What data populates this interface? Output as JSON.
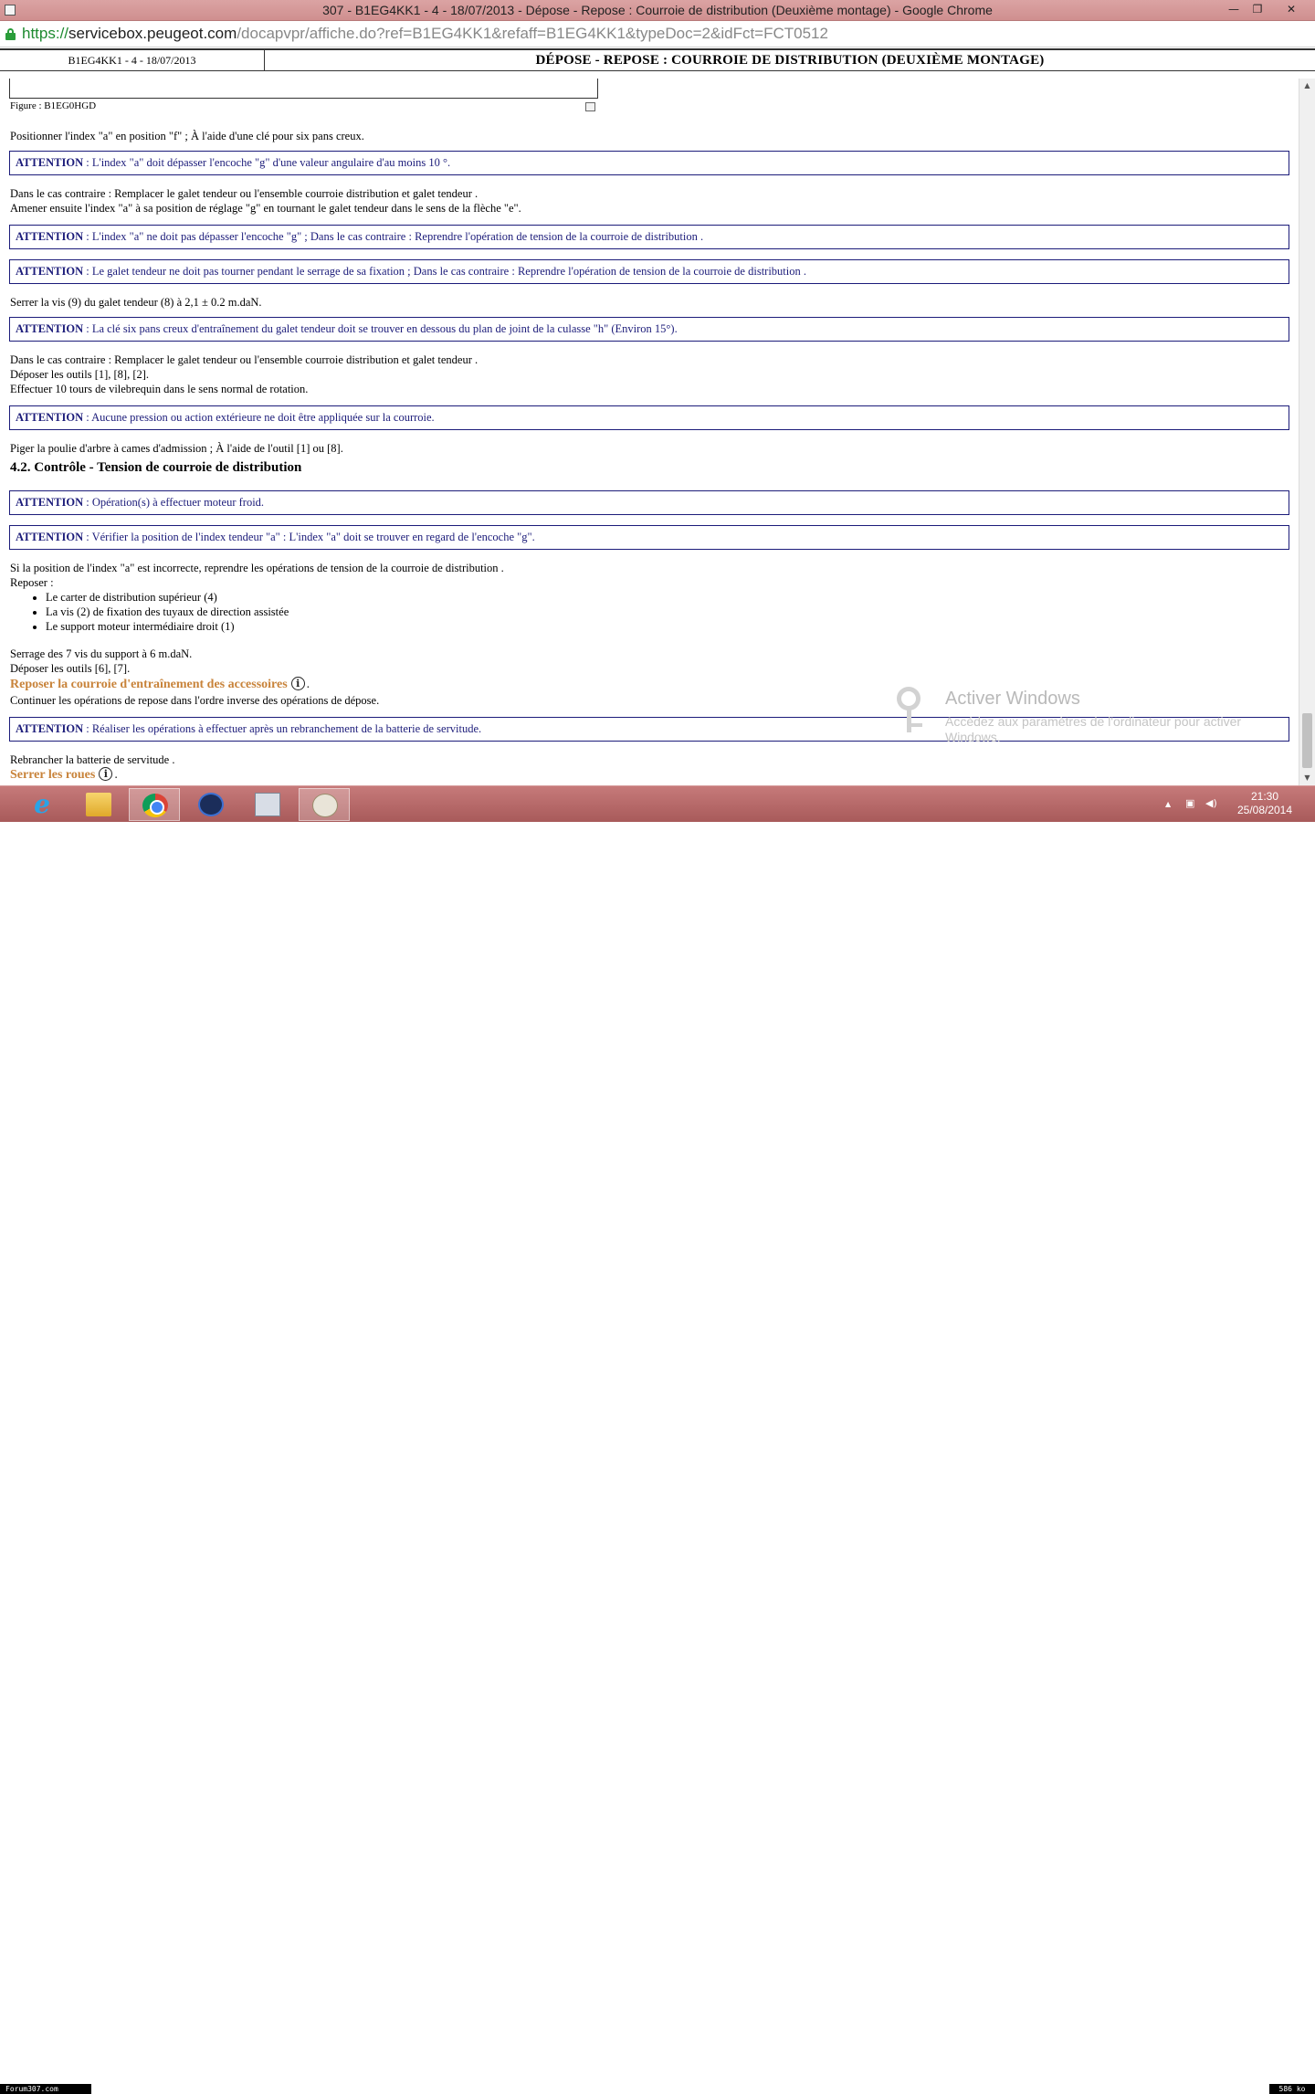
{
  "window": {
    "title": "307 - B1EG4KK1 - 4 - 18/07/2013 - Dépose - Repose : Courroie de distribution (Deuxième montage) - Google Chrome",
    "controls": {
      "minimize": "—",
      "restore": "❐",
      "close": "✕"
    }
  },
  "address": {
    "scheme": "https://",
    "host": "servicebox.peugeot.com",
    "path": "/docapvpr/affiche.do?ref=B1EG4KK1&refaff=B1EG4KK1&typeDoc=2&idFct=FCT0512"
  },
  "doc_header": {
    "ref": "B1EG4KK1 - 4 - 18/07/2013",
    "title": "DÉPOSE - REPOSE : COURROIE DE DISTRIBUTION (DEUXIÈME MONTAGE)"
  },
  "content": {
    "figure_caption": "Figure : B1EG0HGD",
    "attention_label": "ATTENTION",
    "p1": "Positionner l'index \"a\" en position \"f\" ; À l'aide d'une clé pour six pans creux.",
    "att1": " : L'index \"a\" doit dépasser l'encoche \"g\" d'une valeur angulaire d'au moins 10 °.",
    "p2a": "Dans le cas contraire : Remplacer le galet tendeur ou l'ensemble courroie distribution et galet tendeur .",
    "p2b": "Amener ensuite l'index \"a\" à sa position de réglage \"g\" en tournant le galet tendeur dans le sens de la flèche \"e\".",
    "att2": " : L'index \"a\" ne doit pas dépasser l'encoche \"g\" ; Dans le cas contraire : Reprendre l'opération de tension de la courroie de distribution .",
    "att3": " : Le galet tendeur ne doit pas tourner pendant le serrage de sa fixation ; Dans le cas contraire : Reprendre l'opération de tension de la courroie de distribution .",
    "p3": "Serrer la vis (9) du galet tendeur (8) à 2,1 ± 0.2 m.daN.",
    "att4": " : La clé six pans creux d'entraînement du galet tendeur doit se trouver en dessous du plan de joint de la culasse \"h\" (Environ 15°).",
    "p4a": "Dans le cas contraire : Remplacer le galet tendeur ou l'ensemble courroie distribution et galet tendeur .",
    "p4b": "Déposer les outils [1], [8], [2].",
    "p4c": "Effectuer 10 tours de vilebrequin dans le sens normal de rotation.",
    "att5": " : Aucune pression ou action extérieure ne doit être appliquée sur la courroie.",
    "p5": "Piger la poulie d'arbre à cames d'admission ; À l'aide de l'outil [1] ou [8].",
    "section_heading": "4.2. Contrôle - Tension de courroie de distribution",
    "att6": " : Opération(s) à effectuer moteur froid.",
    "att7": " : Vérifier la position de l'index tendeur \"a\" : L'index \"a\" doit se trouver en regard de l'encoche \"g\".",
    "p6a": "Si la position de l'index \"a\" est incorrecte, reprendre les opérations de tension de la courroie de distribution .",
    "p6b": "Reposer :",
    "list": [
      "Le carter de distribution supérieur (4)",
      "La vis (2) de fixation des tuyaux de direction assistée",
      "Le support moteur intermédiaire droit (1)"
    ],
    "p7a": "Serrage des 7 vis du support à 6 m.daN.",
    "p7b": "Déposer les outils [6], [7].",
    "link1": "Reposer la courroie d'entraînement des accessoires",
    "p8": "Continuer les opérations de repose dans l'ordre inverse des opérations de dépose.",
    "att8": " : Réaliser les opérations à effectuer après un rebranchement de la batterie de servitude.",
    "p9": "Rebrancher la batterie de servitude .",
    "link2": "Serrer les roues",
    "info_glyph": "i",
    "period": "."
  },
  "watermark": {
    "title": "Activer Windows",
    "subtitle": "Accédez aux paramètres de l'ordinateur pour activer Windows."
  },
  "taskbar": {
    "apps": [
      "internet-explorer-icon",
      "file-explorer-icon",
      "chrome-icon",
      "ccleaner-icon",
      "calculator-icon",
      "paint-icon"
    ],
    "ie_glyph": "e",
    "tray_chevron": "▲",
    "network_glyph": "▣",
    "volume_glyph": "◀)",
    "time": "21:30",
    "date": "25/08/2014"
  },
  "footer": {
    "forum": "Forum307.com",
    "size": "586 ko"
  }
}
